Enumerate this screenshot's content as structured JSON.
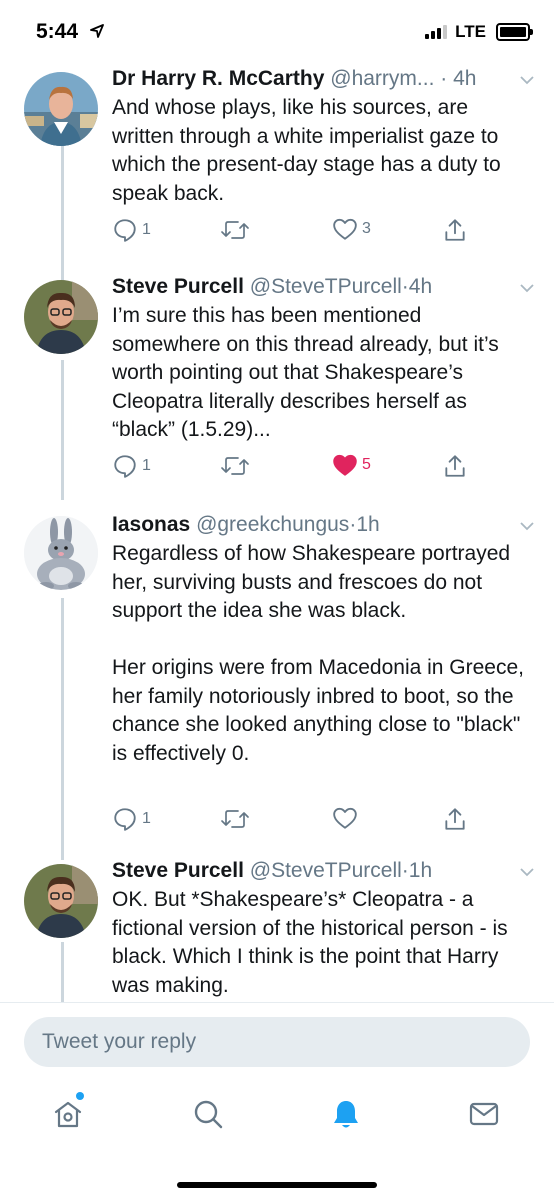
{
  "status_bar": {
    "time": "5:44",
    "network": "LTE",
    "location_arrow": "location-arrow-icon"
  },
  "tweets": [
    {
      "display_name": "Dr Harry R. McCarthy",
      "handle": "@harrym...",
      "time": "4h",
      "text": "And whose plays, like his sources, are written through a white imperialist gaze to which the present-day stage has a duty to speak back.",
      "replies": "1",
      "retweets": "",
      "likes": "3",
      "liked": false
    },
    {
      "display_name": "Steve Purcell",
      "handle": "@SteveTPurcell",
      "time": "4h",
      "text": "I’m sure this has been mentioned somewhere on this thread already, but it’s worth pointing out that Shakespeare’s Cleopatra literally describes herself as “black” (1.5.29)...",
      "replies": "1",
      "retweets": "",
      "likes": "5",
      "liked": true
    },
    {
      "display_name": "Iasonas",
      "handle": "@greekchungus",
      "time": "1h",
      "text": "Regardless of how Shakespeare portrayed her, surviving busts and frescoes do not support the idea she was black.\n\nHer origins were from Macedonia in Greece, her family notoriously inbred to boot, so the chance she looked anything close to \"black\" is effectively 0.",
      "replies": "1",
      "retweets": "",
      "likes": "",
      "liked": false
    },
    {
      "display_name": "Steve Purcell",
      "handle": "@SteveTPurcell",
      "time": "1h",
      "text": "OK. But *Shakespeare’s* Cleopatra - a fictional version of the historical person - is black. Which I think is the point that Harry was making.",
      "replies": "",
      "retweets": "",
      "likes": "",
      "liked": false
    }
  ],
  "reply_bar": {
    "placeholder": "Tweet your reply"
  },
  "tab_bar": {
    "items": [
      "home-icon",
      "search-icon",
      "notifications-icon",
      "messages-icon"
    ],
    "active": "notifications-icon"
  },
  "colors": {
    "accent": "#1da1f2",
    "like": "#e0245e",
    "secondary_text": "#657786",
    "thread_line": "#ccd6dd"
  }
}
